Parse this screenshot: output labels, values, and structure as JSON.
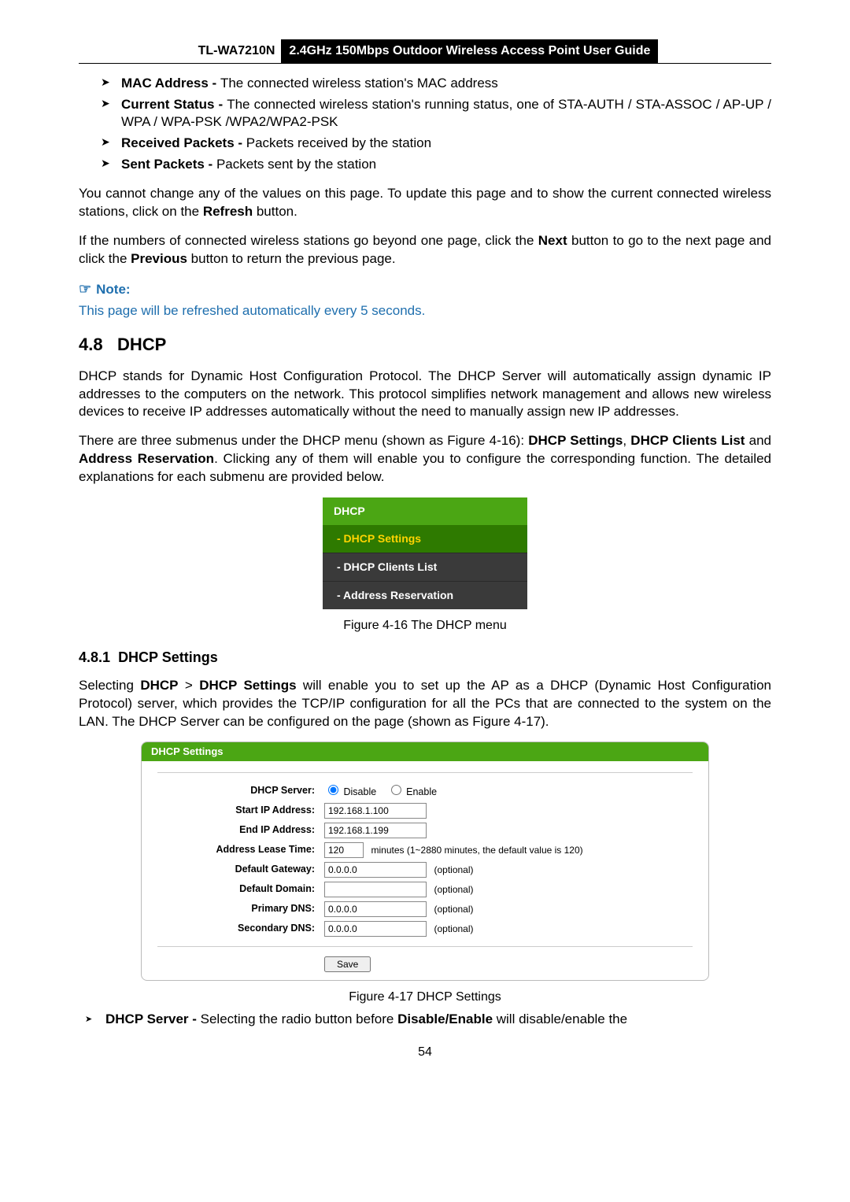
{
  "header": {
    "model": "TL-WA7210N",
    "title": "2.4GHz 150Mbps Outdoor Wireless Access Point User Guide"
  },
  "bullets_top": [
    {
      "b": "MAC Address - ",
      "t": "The connected wireless station's MAC address"
    },
    {
      "b": "Current Status - ",
      "t": "The connected wireless station's running status, one of STA-AUTH / STA-ASSOC / AP-UP / WPA / WPA-PSK /WPA2/WPA2-PSK"
    },
    {
      "b": "Received Packets - ",
      "t": "Packets received by the station"
    },
    {
      "b": "Sent Packets - ",
      "t": "Packets sent by the station"
    }
  ],
  "para1_a": "You cannot change any of the values on this page. To update this page and to show the current connected wireless stations, click on the ",
  "para1_b": "Refresh",
  "para1_c": " button.",
  "para2_a": "If the numbers of connected wireless stations go beyond one page, click the ",
  "para2_b": "Next",
  "para2_c": " button to go to the next page and click the ",
  "para2_d": "Previous",
  "para2_e": " button to return the previous page.",
  "note_label": "Note:",
  "note_text": "This page will be refreshed automatically every 5 seconds.",
  "section_num": "4.8",
  "section_title": "DHCP",
  "dhcp_intro": "DHCP stands for Dynamic Host Configuration Protocol. The DHCP Server will automatically assign dynamic IP addresses to the computers on the network. This protocol simplifies network management and allows new wireless devices to receive IP addresses automatically without the need to manually assign new IP addresses.",
  "dhcp_sub_a": "There are three submenus under the DHCP menu (shown as Figure 4-16): ",
  "dhcp_sub_b": "DHCP Settings",
  "dhcp_sub_c": ", ",
  "dhcp_sub_d": "DHCP Clients List",
  "dhcp_sub_e": " and ",
  "dhcp_sub_f": "Address Reservation",
  "dhcp_sub_g": ". Clicking any of them will enable you to configure the corresponding function. The detailed explanations for each submenu are provided below.",
  "menu": {
    "head": "DHCP",
    "items": [
      "- DHCP Settings",
      "- DHCP Clients List",
      "- Address Reservation"
    ]
  },
  "fig16": "Figure 4-16 The DHCP menu",
  "subsection_num": "4.8.1",
  "subsection_title": "DHCP Settings",
  "sel_a": "Selecting ",
  "sel_b": "DHCP",
  "sel_c": " > ",
  "sel_d": "DHCP Settings",
  "sel_e": " will enable you to set up the AP as a DHCP (Dynamic Host Configuration Protocol) server, which provides the TCP/IP configuration for all the PCs that are connected to the system on the LAN. The DHCP Server can be configured on the page (shown as Figure 4-17).",
  "panel": {
    "title": "DHCP Settings",
    "labels": {
      "server": "DHCP Server:",
      "start": "Start IP Address:",
      "end": "End IP Address:",
      "lease": "Address Lease Time:",
      "gateway": "Default Gateway:",
      "domain": "Default Domain:",
      "pdns": "Primary DNS:",
      "sdns": "Secondary DNS:"
    },
    "radio_disable": "Disable",
    "radio_enable": "Enable",
    "values": {
      "start": "192.168.1.100",
      "end": "192.168.1.199",
      "lease": "120",
      "gateway": "0.0.0.0",
      "domain": "",
      "pdns": "0.0.0.0",
      "sdns": "0.0.0.0"
    },
    "lease_hint": "minutes (1~2880 minutes, the default value is 120)",
    "optional": "(optional)",
    "save": "Save"
  },
  "fig17": "Figure 4-17 DHCP Settings",
  "bullet_bottom_b": "DHCP Server - ",
  "bullet_bottom_t1": "Selecting the radio button before ",
  "bullet_bottom_t2": "Disable/Enable",
  "bullet_bottom_t3": " will disable/enable the",
  "page_number": "54"
}
